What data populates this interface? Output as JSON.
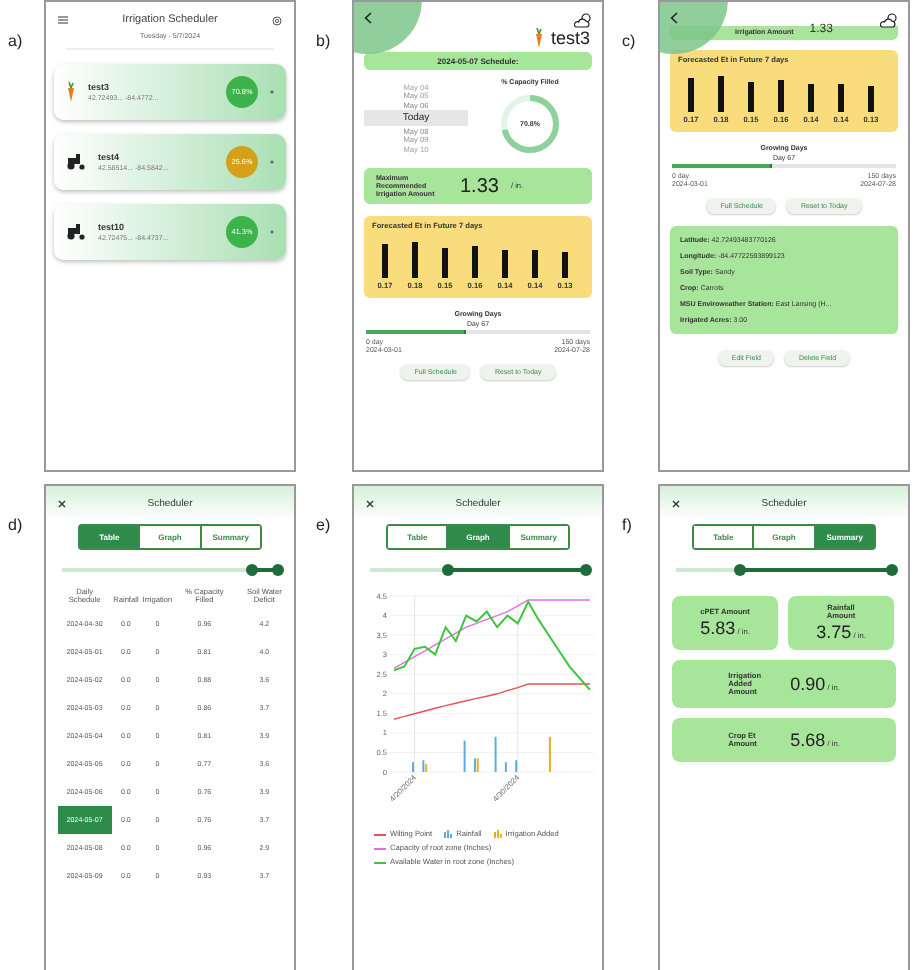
{
  "panels": [
    {
      "label": "a)",
      "kind": "home",
      "title": "Irrigation Scheduler",
      "date": "Tuesday - 5/7/2024",
      "fields": [
        {
          "kind": "carrot",
          "name": "test3",
          "coords": "42.72493... -84.4772...",
          "badge": "70.8%",
          "color": "#3cb44b"
        },
        {
          "kind": "tractor",
          "name": "test4",
          "coords": "42.58514... -84.5842...",
          "badge": "25.6%",
          "color": "#d4a017"
        },
        {
          "kind": "tractor",
          "name": "test10",
          "coords": "42.72475... -84.4737...",
          "badge": "41.3%",
          "color": "#3cb44b"
        }
      ]
    },
    {
      "label": "b)",
      "kind": "field_top",
      "name": "test3",
      "schedule": "2024-05-07 Schedule:",
      "dates": [
        {
          "label": "May 04",
          "selected": false
        },
        {
          "label": "May 05",
          "selected": false
        },
        {
          "label": "May 06",
          "selected": false
        },
        {
          "label": "Today",
          "selected": true
        },
        {
          "label": "May 08",
          "selected": false
        },
        {
          "label": "May 09",
          "selected": false
        },
        {
          "label": "May 10",
          "selected": false
        }
      ],
      "gauge": {
        "title": "% Capacity Filled",
        "reading": "70.8%",
        "level": 0.708
      },
      "max_irrigation": {
        "label": "Maximum Recommended Irrigation Amount",
        "value": "1.33",
        "unit": "/ in."
      },
      "forecast": {
        "title": "Forecasted Et in Future 7 days",
        "values": [
          "0.17",
          "0.18",
          "0.15",
          "0.16",
          "0.14",
          "0.14",
          "0.13"
        ]
      },
      "growing": {
        "title": "Growing Days",
        "day": "Day 67",
        "level": 0.447,
        "start": "0 day",
        "start_date": "2024-03-01",
        "end": "150 days",
        "end_date": "2024-07-28"
      },
      "buttons": [
        "Full Schedule",
        "Reset to Today"
      ]
    },
    {
      "label": "c)",
      "kind": "field_bottom",
      "cut_card": {
        "label": "Irrigation Amount",
        "value": "1.33"
      },
      "forecast": {
        "title": "Forecasted Et in Future 7 days",
        "values": [
          "0.17",
          "0.18",
          "0.15",
          "0.16",
          "0.14",
          "0.14",
          "0.13"
        ]
      },
      "growing": {
        "title": "Growing Days",
        "day": "Day 67",
        "level": 0.447,
        "start": "0 day",
        "start_date": "2024-03-01",
        "end": "150 days",
        "end_date": "2024-07-28"
      },
      "buttons": [
        "Full Schedule",
        "Reset to Today"
      ],
      "info": [
        {
          "label": "Latitude:",
          "value": "42.72493483770126"
        },
        {
          "label": "Longitude:",
          "value": "-84.47722593899123"
        },
        {
          "label": "Soil Type:",
          "value": "Sandy"
        },
        {
          "label": "Crop:",
          "value": "Carrots"
        },
        {
          "label": "MSU Enviroweather Station:",
          "value": "East Lansing (H..."
        },
        {
          "label": "Irrigated Acres:",
          "value": "3.00"
        }
      ],
      "field_buttons": [
        "Edit Field",
        "Delete Field"
      ]
    },
    {
      "label": "d)",
      "kind": "table",
      "title": "Scheduler",
      "tabs": [
        {
          "label": "Table",
          "selected": true
        },
        {
          "label": "Graph",
          "selected": false
        },
        {
          "label": "Summary",
          "selected": false
        }
      ],
      "slider": {
        "handles": [
          {
            "level": 0.88
          },
          {
            "level": 1
          }
        ]
      },
      "columns": [
        "Daily Schedule",
        "Rainfall",
        "Irrigation",
        "% Capacity Filled",
        "Soil Water Deficit"
      ],
      "rows": [
        {
          "cells": [
            "2024-04-30",
            "0.0",
            "0",
            "0.96",
            "4.2"
          ],
          "selected": false
        },
        {
          "cells": [
            "2024-05-01",
            "0.0",
            "0",
            "0.81",
            "4.0"
          ],
          "selected": false
        },
        {
          "cells": [
            "2024-05-02",
            "0.0",
            "0",
            "0.88",
            "3.6"
          ],
          "selected": false
        },
        {
          "cells": [
            "2024-05-03",
            "0.0",
            "0",
            "0.86",
            "3.7"
          ],
          "selected": false
        },
        {
          "cells": [
            "2024-05-04",
            "0.0",
            "0",
            "0.81",
            "3.9"
          ],
          "selected": false
        },
        {
          "cells": [
            "2024-05-05",
            "0.0",
            "0",
            "0.77",
            "3.6"
          ],
          "selected": false
        },
        {
          "cells": [
            "2024-05-06",
            "0.0",
            "0",
            "0.76",
            "3.9"
          ],
          "selected": false
        },
        {
          "cells": [
            "2024-05-07",
            "0.0",
            "0",
            "0.76",
            "3.7"
          ],
          "selected": true
        },
        {
          "cells": [
            "2024-05-08",
            "0.0",
            "0",
            "0.96",
            "2.9"
          ],
          "selected": false
        },
        {
          "cells": [
            "2024-05-09",
            "0.0",
            "0",
            "0.93",
            "3.7"
          ],
          "selected": false
        }
      ]
    },
    {
      "label": "e)",
      "kind": "graph",
      "title": "Scheduler",
      "tabs": [
        {
          "label": "Table",
          "selected": false
        },
        {
          "label": "Graph",
          "selected": true
        },
        {
          "label": "Summary",
          "selected": false
        }
      ],
      "slider": {
        "handles": [
          {
            "level": 0.36
          },
          {
            "level": 1
          }
        ]
      },
      "chart_data": {
        "type": "line",
        "grid": true,
        "yticks": [
          0,
          0.5,
          1,
          1.5,
          2,
          2.5,
          3,
          3.5,
          4,
          4.5
        ],
        "ylim": [
          0,
          4.5
        ],
        "categories": [
          null,
          null,
          "4/20/2024",
          null,
          null,
          null,
          null,
          null,
          null,
          null,
          null,
          null,
          "4/30/2024",
          null,
          null,
          null,
          null,
          null,
          null,
          null
        ],
        "series": [
          {
            "name": "Wilting Point",
            "color": "#e05555",
            "type": "line",
            "values": [
              1.35,
              1.42,
              1.49,
              1.56,
              1.63,
              1.7,
              1.76,
              1.82,
              1.88,
              1.94,
              2.0,
              2.08,
              2.16,
              2.25,
              2.25,
              2.25,
              2.25,
              2.25,
              2.25,
              2.25
            ]
          },
          {
            "name": "Rainfall",
            "color": "#5aaee0",
            "type": "bar",
            "values": [
              0,
              null,
              0.25,
              0.3,
              0,
              null,
              0,
              0.8,
              0.35,
              0,
              0.9,
              0.25,
              0.3,
              0,
              0,
              0,
              0,
              0,
              0,
              0
            ]
          },
          {
            "name": "Irrigation Added",
            "color": "#e8b020",
            "type": "bar",
            "values": [
              0,
              0,
              0,
              0.2,
              0,
              0,
              0,
              0,
              0.35,
              0,
              0,
              0,
              0,
              0,
              0,
              0.9,
              0,
              0,
              0,
              0
            ]
          },
          {
            "name": "Capacity of root zone (Inches)",
            "color": "#e070e0",
            "type": "line",
            "values": [
              2.65,
              2.8,
              2.95,
              3.1,
              3.25,
              3.4,
              3.55,
              3.7,
              3.8,
              3.9,
              4.0,
              4.1,
              4.25,
              4.4,
              4.4,
              4.4,
              4.4,
              4.4,
              4.4,
              4.4
            ]
          },
          {
            "name": "Available Water in root zone (Inches)",
            "color": "#3ec43e",
            "type": "line",
            "values": [
              2.6,
              2.7,
              3.15,
              3.2,
              3.0,
              3.7,
              3.35,
              4.0,
              3.85,
              4.1,
              3.7,
              4.0,
              3.8,
              4.35,
              3.9,
              3.5,
              3.1,
              2.7,
              2.4,
              2.1
            ]
          }
        ]
      }
    },
    {
      "label": "f)",
      "kind": "summary",
      "title": "Scheduler",
      "tabs": [
        {
          "label": "Table",
          "selected": false
        },
        {
          "label": "Graph",
          "selected": false
        },
        {
          "label": "Summary",
          "selected": true
        }
      ],
      "slider": {
        "handles": [
          {
            "level": 0.3
          },
          {
            "level": 1
          }
        ]
      },
      "cards": [
        {
          "kind": "half",
          "label": "cPET Amount",
          "value": "5.83",
          "unit": "/ in."
        },
        {
          "kind": "half",
          "label": "Rainfall Amount",
          "value": "3.75",
          "unit": "/ in."
        },
        {
          "kind": "full",
          "label": "Irrigation Added Amount",
          "value": "0.90",
          "unit": "/ in."
        },
        {
          "kind": "full",
          "label": "Crop Et Amount",
          "value": "5.68",
          "unit": "/ in."
        }
      ]
    }
  ]
}
